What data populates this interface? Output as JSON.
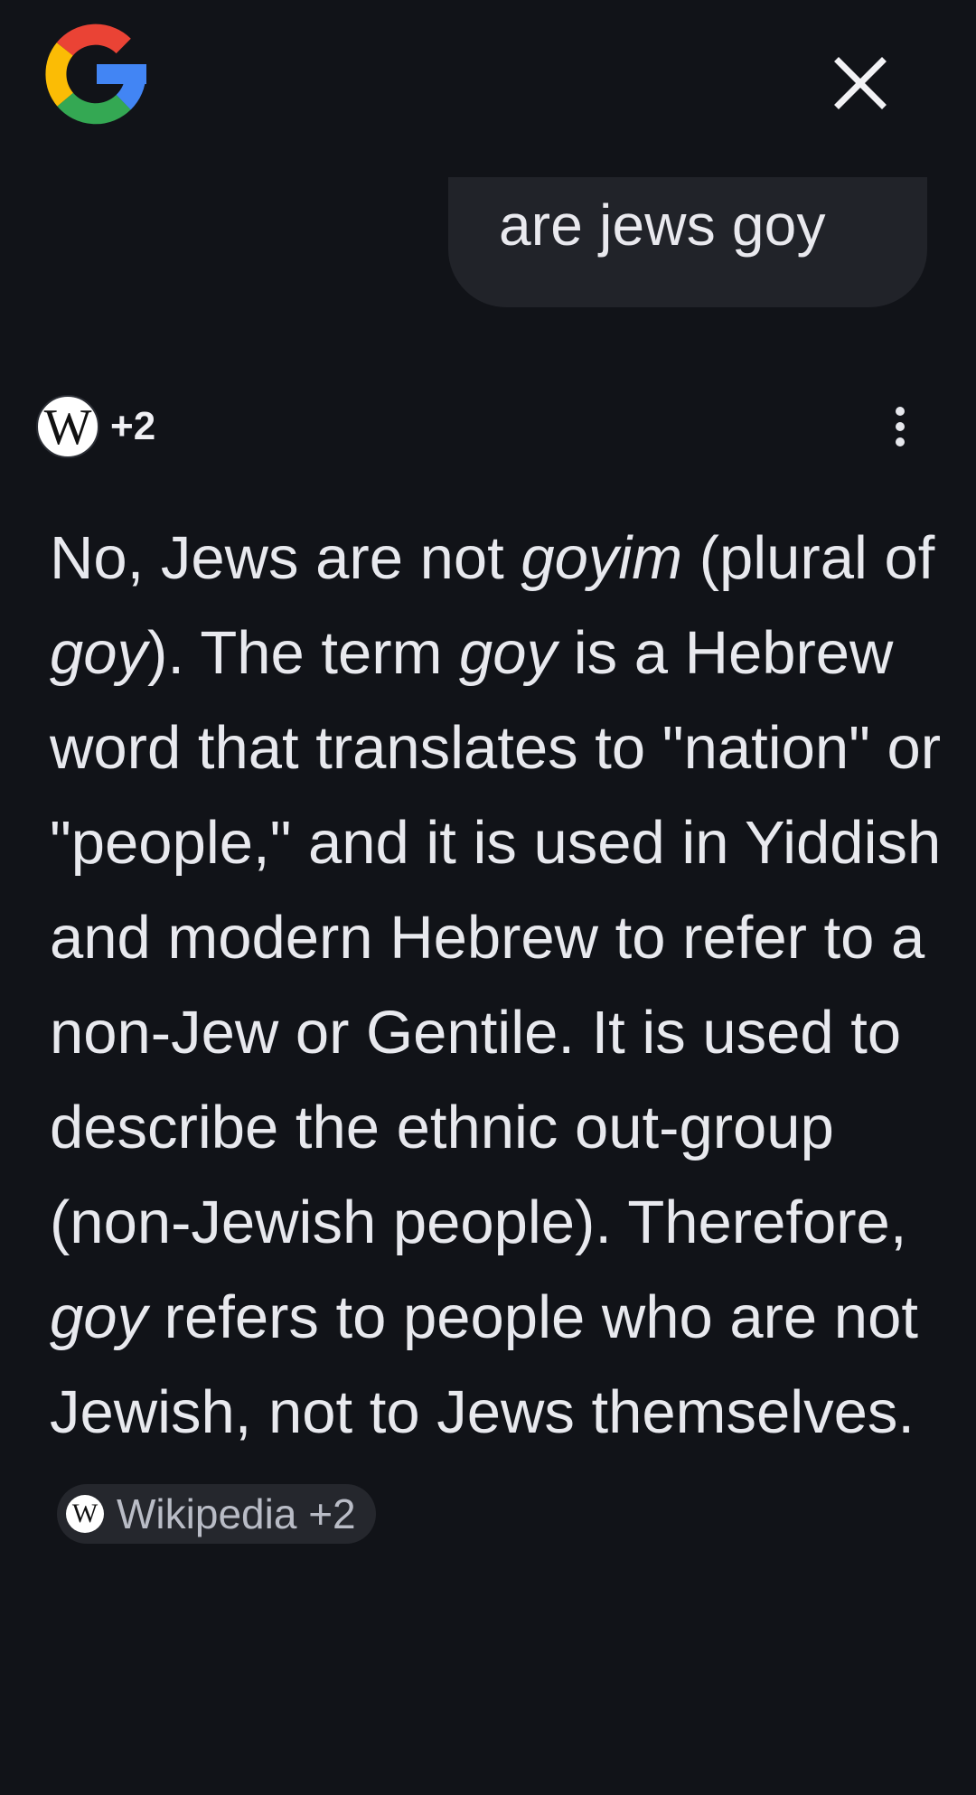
{
  "header": {
    "logo_icon": "google-g-logo",
    "close_icon": "close-x-icon"
  },
  "query": {
    "text": "are jews goy"
  },
  "sources": {
    "icon": "wikipedia-w-icon",
    "icon_glyph": "W",
    "extra_count": "+2",
    "menu_icon": "more-vertical-icon"
  },
  "answer": {
    "s1": "No, Jews are not ",
    "i1": "goyim",
    "s2": " (plural of ",
    "i2": "goy",
    "s3": "). The term ",
    "i3": "goy",
    "s4": " is a Hebrew word that translates to \"nation\" or \"people,\" and it is used in Yiddish and modern Hebrew to refer to a non-Jew or Gentile. It is used to describe the ethnic out-group (non-Jewish people). Therefore, ",
    "i4": "goy",
    "s5": " refers to people who are not Jewish, not to Jews themselves.",
    "citation": {
      "icon_glyph": "W",
      "label": "Wikipedia +2"
    }
  },
  "colors": {
    "background": "#111318",
    "bubble": "#212329",
    "chip": "#25272d",
    "text": "#e8e9ee",
    "google_blue": "#4285F4",
    "google_red": "#EA4335",
    "google_yellow": "#FBBC05",
    "google_green": "#34A853"
  }
}
